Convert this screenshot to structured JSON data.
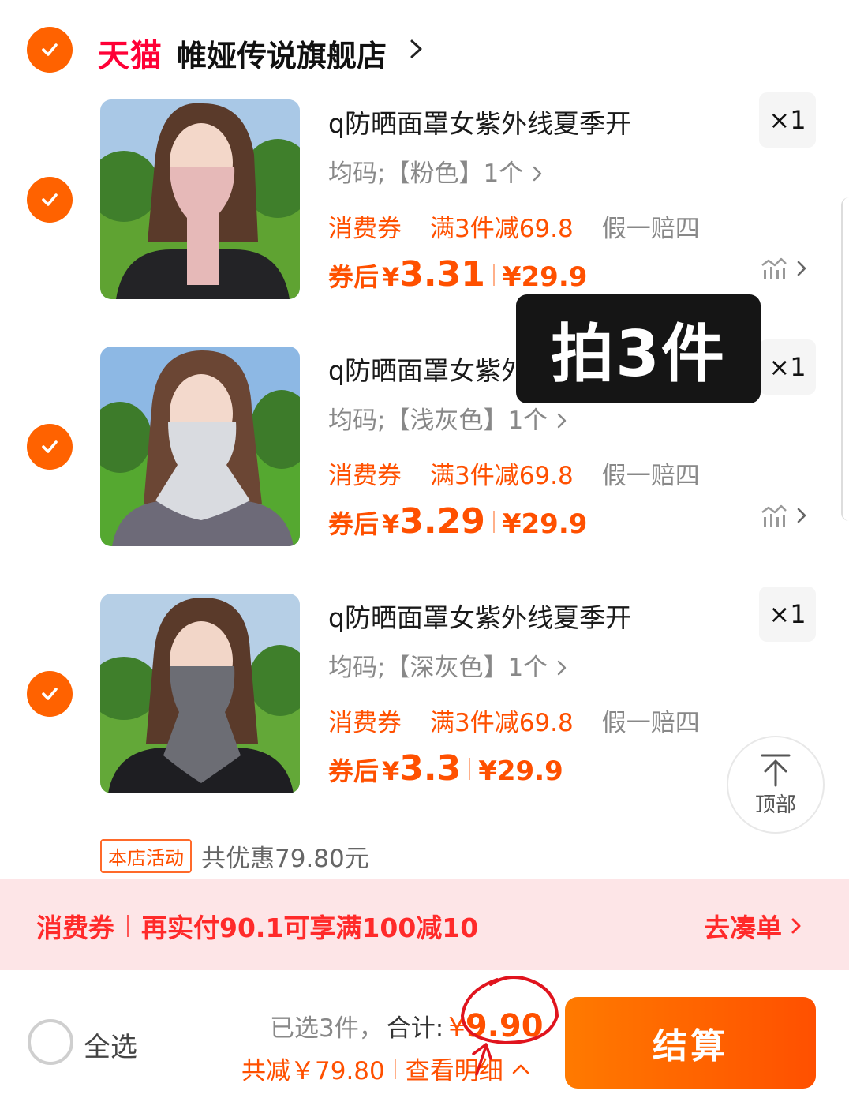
{
  "store": {
    "platform_logo": "天猫",
    "name": "帷娅传说旗舰店"
  },
  "items": [
    {
      "title": "q防晒面罩女紫外线夏季开",
      "qty": "×1",
      "sku": "均码;【粉色】1个",
      "promo_coupon": "消费券",
      "promo_full": "满3件减69.8",
      "promo_fake": "假一赔四",
      "after_label": "券后",
      "after_yen": "¥",
      "after_price": "3.31",
      "orig_price": "¥29.9",
      "mask_color": "#e6b9b8"
    },
    {
      "title": "q防晒面罩女紫外线夏季开",
      "qty": "×1",
      "sku": "均码;【浅灰色】1个",
      "promo_coupon": "消费券",
      "promo_full": "满3件减69.8",
      "promo_fake": "假一赔四",
      "after_label": "券后",
      "after_yen": "¥",
      "after_price": "3.29",
      "orig_price": "¥29.9",
      "mask_color": "#d9dbe0"
    },
    {
      "title": "q防晒面罩女紫外线夏季开",
      "qty": "×1",
      "sku": "均码;【深灰色】1个",
      "promo_coupon": "消费券",
      "promo_full": "满3件减69.8",
      "promo_fake": "假一赔四",
      "after_label": "券后",
      "after_yen": "¥",
      "after_price": "3.3",
      "orig_price": "¥29.9",
      "mask_color": "#6c6d74"
    }
  ],
  "overlay_text": "拍3件",
  "float_top_label": "顶部",
  "shop_activity": {
    "badge": "本店活动",
    "text": "共优惠79.80元"
  },
  "coupon_bar": {
    "label": "消费券",
    "text": "再实付90.1可享满100减10",
    "action": "去凑单"
  },
  "bottom_bar": {
    "select_all": "全选",
    "selected_count": "已选3件，",
    "total_label": "合计:",
    "total_yen": "¥",
    "total_value": "9.90",
    "saving": "共减￥79.80",
    "detail": "查看明细",
    "checkout": "结算"
  },
  "colors": {
    "accent": "#ff5000",
    "check": "#ff6200",
    "tmall": "#ff0036",
    "coupon_bar_bg": "#fde5e7",
    "annotation": "#e0141e"
  },
  "icons": [
    "check-icon",
    "chevron-right-icon",
    "price-trend-icon",
    "arrow-up-icon",
    "chevron-up-icon"
  ]
}
